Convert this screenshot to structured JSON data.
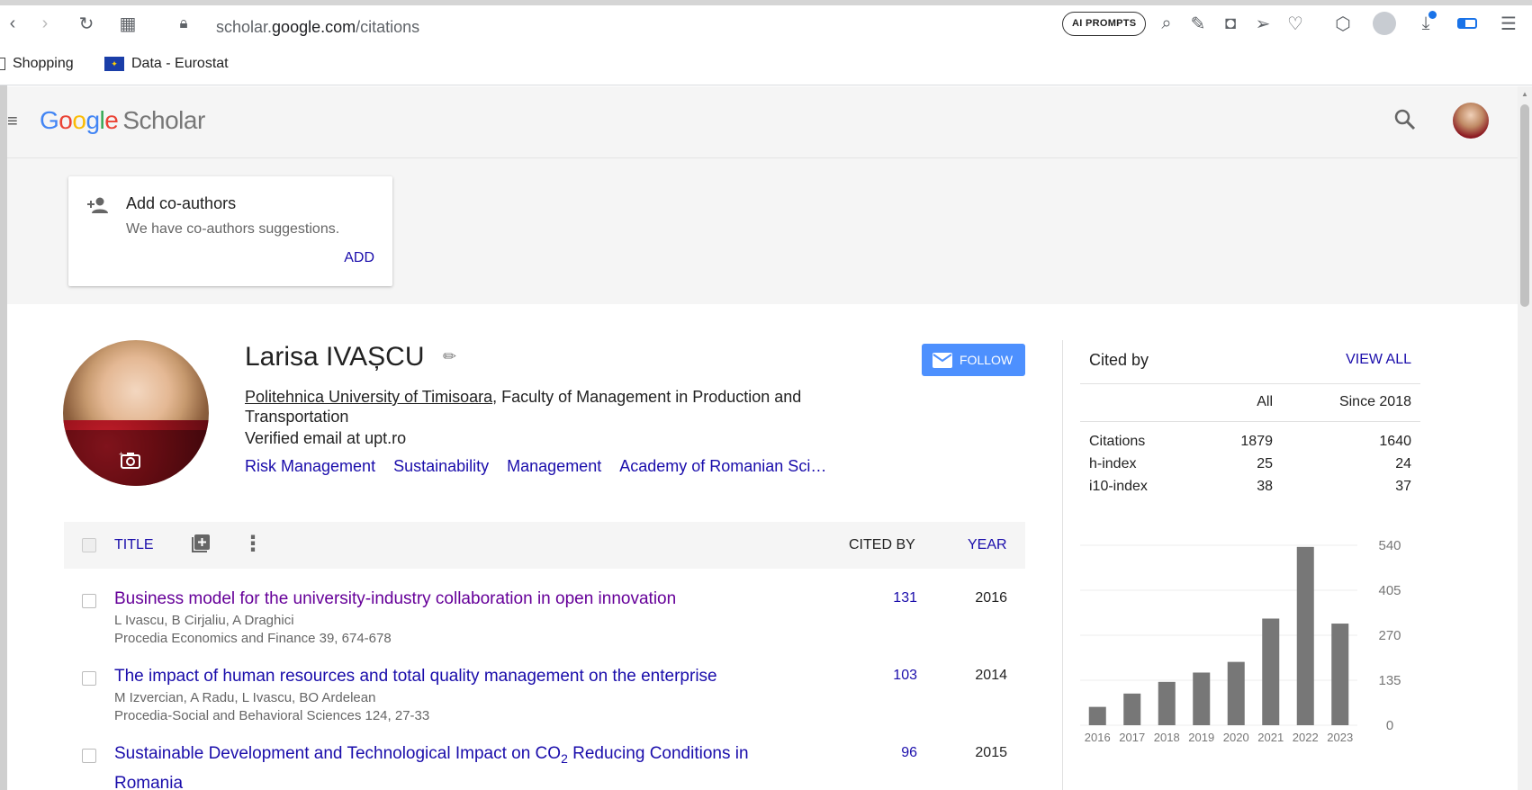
{
  "browser": {
    "url_prefix": "scholar.",
    "url_domain": "google.com",
    "url_path": "/citations",
    "ai_prompts": "AI PROMPTS",
    "bookmarks": [
      {
        "label": "Shopping"
      },
      {
        "label": "Data - Eurostat"
      }
    ]
  },
  "scholar": {
    "logo_letters": [
      "G",
      "o",
      "o",
      "g",
      "l",
      "e"
    ],
    "logo_suffix": "Scholar"
  },
  "coauthors": {
    "title": "Add co-authors",
    "subtitle": "We have co-authors suggestions.",
    "add_label": "ADD"
  },
  "profile": {
    "name": "Larisa IVAȘCU",
    "affiliation_link": "Politehnica University of Timisoara",
    "affiliation_rest": ", Faculty of Management in Production and Transportation",
    "email": "Verified email at upt.ro",
    "follow_label": "FOLLOW",
    "topics": [
      "Risk Management",
      "Sustainability",
      "Management",
      "Academy of Romanian Sci…"
    ]
  },
  "table": {
    "title_header": "TITLE",
    "cited_header": "CITED BY",
    "year_header": "YEAR",
    "rows": [
      {
        "title": "Business model for the university-industry collaboration in open innovation",
        "authors": "L Ivascu, B Cirjaliu, A Draghici",
        "venue": "Procedia Economics and Finance 39, 674-678",
        "cited": "131",
        "year": "2016"
      },
      {
        "title": "The impact of human resources and total quality management on the enterprise",
        "authors": "M Izvercian, A Radu, L Ivascu, BO Ardelean",
        "venue": "Procedia-Social and Behavioral Sciences 124, 27-33",
        "cited": "103",
        "year": "2014"
      },
      {
        "title_part1": "Sustainable Development and Technological Impact on CO",
        "title_sub": "2",
        "title_part2": " Reducing Conditions in Romania",
        "cited": "96",
        "year": "2015"
      }
    ]
  },
  "cited_by": {
    "title": "Cited by",
    "view_all": "VIEW ALL",
    "col_all": "All",
    "col_since": "Since 2018",
    "rows": [
      {
        "label": "Citations",
        "all": "1879",
        "since": "1640"
      },
      {
        "label": "h-index",
        "all": "25",
        "since": "24"
      },
      {
        "label": "i10-index",
        "all": "38",
        "since": "37"
      }
    ]
  },
  "chart_data": {
    "type": "bar",
    "categories": [
      "2016",
      "2017",
      "2018",
      "2019",
      "2020",
      "2021",
      "2022",
      "2023"
    ],
    "values": [
      55,
      95,
      130,
      158,
      190,
      320,
      535,
      305
    ],
    "ylim": [
      0,
      540
    ],
    "yticks": [
      0,
      135,
      270,
      405,
      540
    ],
    "bar_color": "#777777"
  },
  "colors": {
    "link": "#1a0dab",
    "visited": "#660099",
    "follow": "#4d90fe"
  }
}
